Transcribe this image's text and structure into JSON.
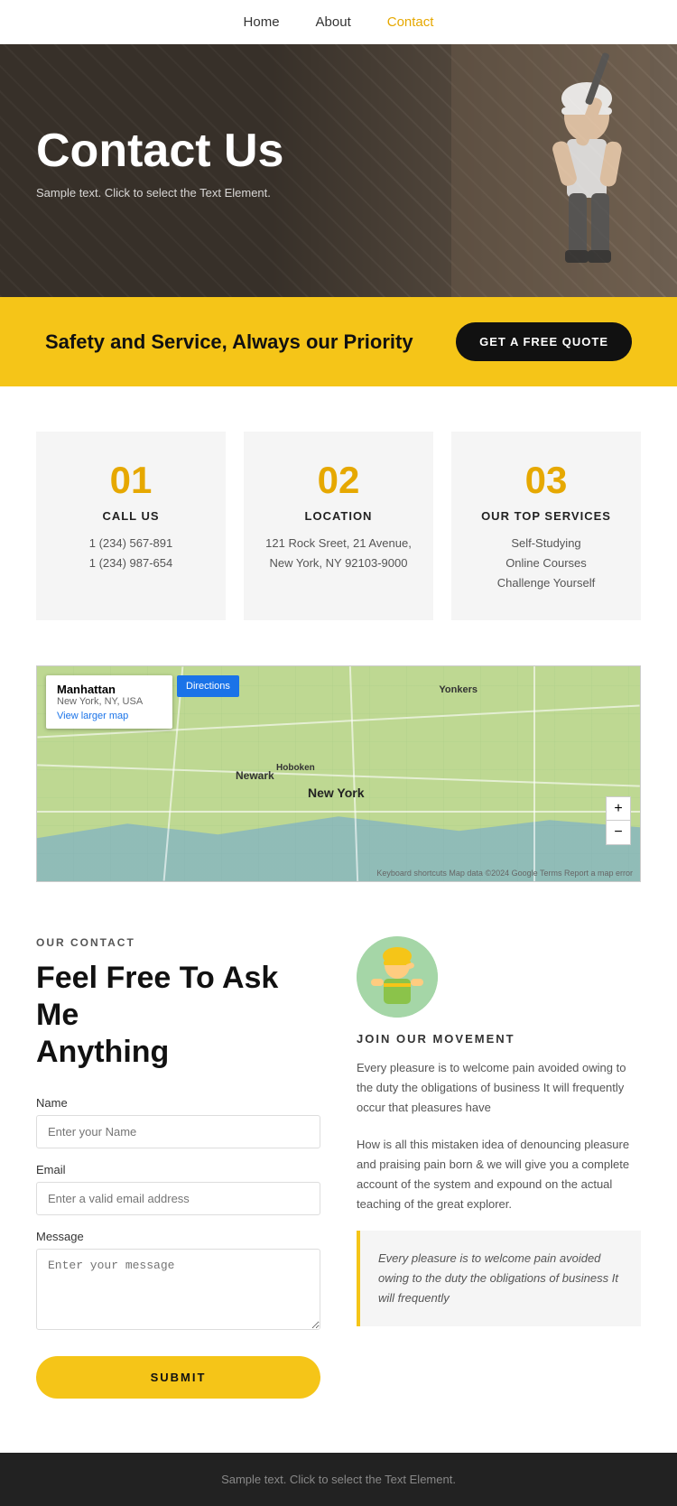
{
  "nav": {
    "links": [
      {
        "label": "Home",
        "href": "#",
        "active": false
      },
      {
        "label": "About",
        "href": "#",
        "active": false
      },
      {
        "label": "Contact",
        "href": "#",
        "active": true
      }
    ]
  },
  "hero": {
    "title": "Contact Us",
    "subtitle": "Sample text. Click to select the Text Element."
  },
  "banner": {
    "text": "Safety and Service, Always our Priority",
    "button_label": "GET A FREE QUOTE"
  },
  "info_cards": [
    {
      "number": "01",
      "title": "CALL US",
      "lines": [
        "1 (234) 567-891",
        "1 (234) 987-654"
      ]
    },
    {
      "number": "02",
      "title": "LOCATION",
      "lines": [
        "121 Rock Sreet, 21 Avenue,",
        "New York, NY 92103-9000"
      ]
    },
    {
      "number": "03",
      "title": "OUR TOP SERVICES",
      "lines": [
        "Self-Studying",
        "Online Courses",
        "Challenge Yourself"
      ]
    }
  ],
  "map": {
    "location_name": "Manhattan",
    "location_sub": "New York, NY, USA",
    "view_larger_link": "View larger map",
    "directions_label": "Directions",
    "labels": [
      "New York",
      "Newark",
      "Yonkers",
      "Hoboken"
    ],
    "zoom_plus": "+",
    "zoom_minus": "−",
    "footer_text": "Keyboard shortcuts  Map data ©2024 Google  Terms  Report a map error"
  },
  "contact": {
    "our_contact_label": "OUR CONTACT",
    "heading_line1": "Feel Free To Ask Me",
    "heading_line2": "Anything",
    "form": {
      "name_label": "Name",
      "name_placeholder": "Enter your Name",
      "email_label": "Email",
      "email_placeholder": "Enter a valid email address",
      "message_label": "Message",
      "message_placeholder": "Enter your message",
      "submit_label": "SUBMIT"
    },
    "right": {
      "join_label": "JOIN OUR MOVEMENT",
      "para1": "Every pleasure is to welcome pain avoided owing to the duty the obligations of business It will frequently occur that pleasures have",
      "para2": "How is all this mistaken idea of denouncing pleasure and praising pain born & we will give you a complete account of the system and expound on the actual teaching of the great explorer.",
      "quote": "Every pleasure is to welcome pain avoided owing to the duty the obligations of business It will frequently"
    }
  },
  "footer": {
    "text": "Sample text. Click to select the Text Element."
  }
}
